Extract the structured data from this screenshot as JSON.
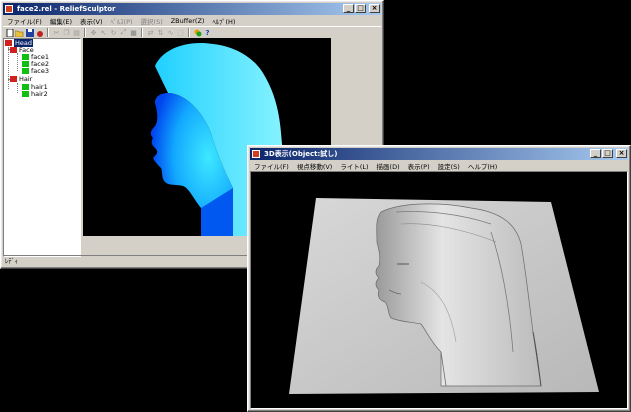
{
  "main_window": {
    "title": "face2.rel - ReliefSculptor",
    "menus": [
      "ファイル(F)",
      "編集(E)",
      "表示(V)",
      "ﾍﾟﾙｽ(P)",
      "選択(S)",
      "ZBuffer(Z)",
      "ﾍﾙﾌﾟ(H)"
    ],
    "menus_disabled": [
      false,
      false,
      false,
      true,
      true,
      false,
      false
    ],
    "tree": {
      "root": "Head",
      "groups": [
        {
          "label": "Face",
          "children": [
            "face1",
            "face2",
            "face3"
          ]
        },
        {
          "label": "Hair",
          "children": [
            "hair1",
            "hair2"
          ]
        }
      ]
    },
    "status": "ﾚﾃﾞｨ"
  },
  "view3d_window": {
    "title": "3D表示(Object:試し)",
    "menus": [
      "ファイル(F)",
      "視点移動(V)",
      "ライト(L)",
      "描画(D)",
      "表示(P)",
      "設定(S)",
      "ヘルプ(H)"
    ]
  },
  "colors": {
    "titlebar": "#0a246a",
    "face_light": "#3ee8ff",
    "face_dark": "#0066ff",
    "hair_light": "#7ef4ff",
    "relief": "#c8c8c8"
  },
  "icons": [
    "new-icon",
    "open-icon",
    "save-icon",
    "bomb-icon",
    "cut-icon",
    "copy-icon",
    "paste-icon",
    "move-icon",
    "pointer-icon",
    "rotate-icon",
    "scale-icon",
    "fill-icon",
    "flip-icon",
    "mirror-icon",
    "curve-icon",
    "select-icon",
    "color-icon",
    "help-icon"
  ]
}
